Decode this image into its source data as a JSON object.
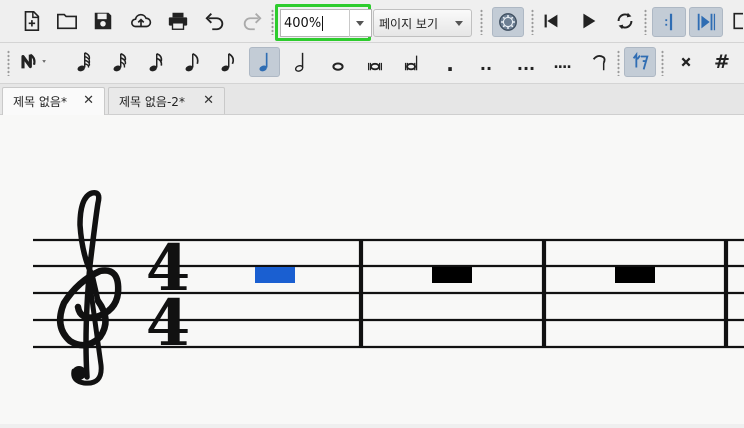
{
  "toolbar1": {
    "zoom_value": "400%",
    "view_mode": "페이지 보기",
    "icons": [
      "new-file-icon",
      "open-folder-icon",
      "save-icon",
      "cloud-upload-icon",
      "print-icon",
      "undo-icon",
      "redo-icon",
      "mixer-icon",
      "rewind-icon",
      "play-icon",
      "loop-icon",
      "playback-pan-icon",
      "metronome-icon"
    ]
  },
  "toolbar2": {
    "tools": [
      "note-input-icon",
      "64th-note-icon",
      "32nd-note-icon",
      "16th-note-icon",
      "8th-note-icon",
      "8th-note-flag-icon",
      "quarter-note-icon",
      "half-note-icon",
      "whole-note-icon",
      "breve-icon",
      "longa-icon",
      "dot-icon",
      "double-dot-icon",
      "triple-dot-icon",
      "quadruple-dot-icon",
      "tie-icon",
      "rest-icon",
      "double-flat-icon",
      "sharp-icon"
    ],
    "dots": {
      "single": ".",
      "double": "..",
      "triple": "...",
      "quadruple": "...."
    },
    "sharp_label": "#",
    "double_flat_label": "𝄪"
  },
  "tabs": [
    {
      "label": "제목 없음*",
      "close": "✕",
      "active": true
    },
    {
      "label": "제목 없음-2*",
      "close": "✕",
      "active": false
    }
  ],
  "score": {
    "time_signature_top": "4",
    "time_signature_bottom": "4",
    "selected_color": "#1a5fd1",
    "rest_color": "#000000"
  }
}
